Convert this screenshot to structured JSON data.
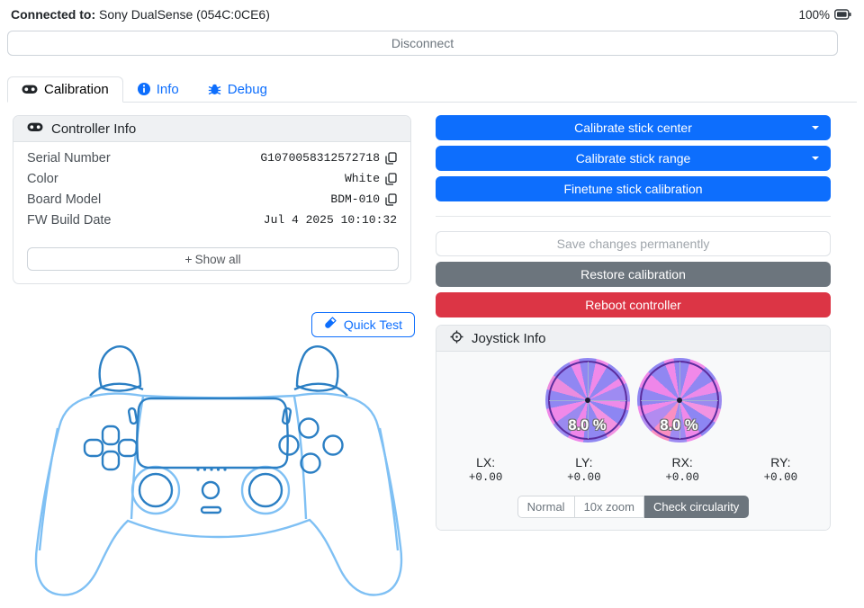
{
  "header": {
    "connected_label": "Connected to:",
    "device_name": "Sony DualSense (054C:0CE6)",
    "battery_level": "100%",
    "disconnect_label": "Disconnect"
  },
  "tabs": [
    {
      "label": "Calibration",
      "icon": "gamepad-icon",
      "active": true
    },
    {
      "label": "Info",
      "icon": "info-circle-icon",
      "active": false
    },
    {
      "label": "Debug",
      "icon": "bug-icon",
      "active": false
    }
  ],
  "controller_info": {
    "title": "Controller Info",
    "rows": [
      {
        "label": "Serial Number",
        "value": "G1070058312572718",
        "copyable": true
      },
      {
        "label": "Color",
        "value": "White",
        "copyable": true
      },
      {
        "label": "Board Model",
        "value": "BDM-010",
        "copyable": true
      },
      {
        "label": "FW Build Date",
        "value": "Jul 4 2025 10:10:32",
        "copyable": false
      }
    ],
    "show_all": {
      "icon": "+",
      "label": "Show all"
    }
  },
  "quick_test": {
    "label": "Quick Test",
    "icon": "vial-icon"
  },
  "actions": {
    "calibrate_center": "Calibrate stick center",
    "calibrate_range": "Calibrate stick range",
    "finetune": "Finetune stick calibration",
    "save": "Save changes permanently",
    "restore": "Restore calibration",
    "reboot": "Reboot controller"
  },
  "joystick_info": {
    "title": "Joystick Info",
    "icon": "crosshairs-icon",
    "gauges": [
      {
        "name": "left-stick",
        "circularity_error": "8.0 %"
      },
      {
        "name": "right-stick",
        "circularity_error": "8.0 %"
      }
    ],
    "axes": [
      {
        "label": "LX:",
        "value": "+0.00"
      },
      {
        "label": "LY:",
        "value": "+0.00"
      },
      {
        "label": "RX:",
        "value": "+0.00"
      },
      {
        "label": "RY:",
        "value": "+0.00"
      }
    ],
    "view_buttons": [
      {
        "label": "Normal",
        "active": false
      },
      {
        "label": "10x zoom",
        "active": false
      },
      {
        "label": "Check circularity",
        "active": true
      }
    ]
  }
}
